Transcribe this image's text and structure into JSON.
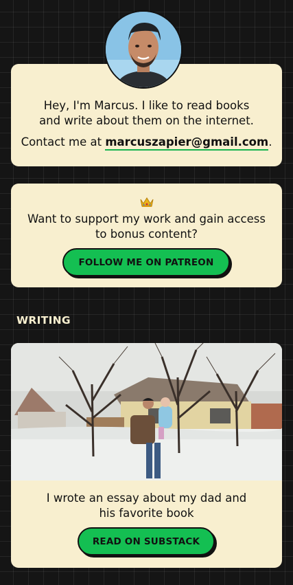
{
  "profile": {
    "avatar_alt": "Marcus profile photo",
    "bio": "Hey, I'm Marcus. I like to read books and write about them on the internet.",
    "contact_prefix": "Contact me at ",
    "email": "marcuszapier@gmail.com",
    "contact_suffix": "."
  },
  "support": {
    "icon": "crown-icon",
    "text": "Want to support my work and gain access to bonus content?",
    "button_label": "FOLLOW ME ON PATREON"
  },
  "writing": {
    "heading": "WRITING",
    "items": [
      {
        "image_alt": "Man holding a baby in a snowy yard",
        "text": "I wrote an essay about my dad and his favorite book",
        "button_label": "READ ON SUBSTACK"
      }
    ]
  },
  "colors": {
    "background": "#151515",
    "card": "#f8efcf",
    "accent": "#14bf52",
    "text": "#111111"
  }
}
